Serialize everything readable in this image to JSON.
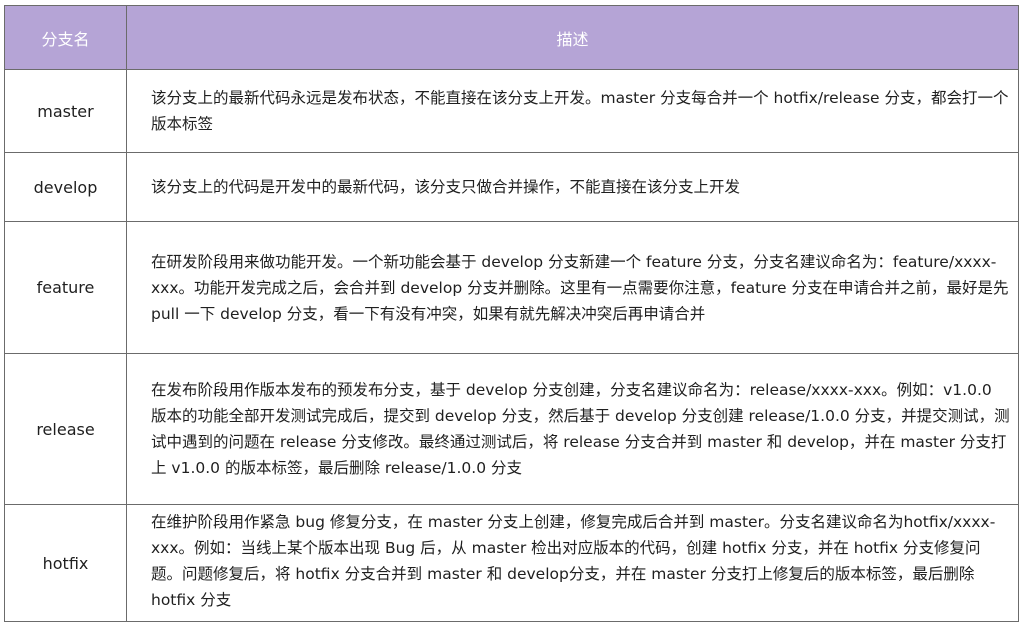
{
  "header": {
    "col_name": "分支名",
    "col_desc": "描述"
  },
  "rows": [
    {
      "name": "master",
      "desc": "该分支上的最新代码永远是发布状态，不能直接在该分支上开发。master 分支每合并一个 hotfix/release 分支，都会打一个版本标签"
    },
    {
      "name": "develop",
      "desc": "该分支上的代码是开发中的最新代码，该分支只做合并操作，不能直接在该分支上开发"
    },
    {
      "name": "feature",
      "desc": "在研发阶段用来做功能开发。一个新功能会基于 develop 分支新建一个 feature 分支，分支名建议命名为：feature/xxxx-xxx。功能开发完成之后，会合并到 develop 分支并删除。这里有一点需要你注意，feature 分支在申请合并之前，最好是先 pull 一下 develop 分支，看一下有没有冲突，如果有就先解决冲突后再申请合并"
    },
    {
      "name": "release",
      "desc": "在发布阶段用作版本发布的预发布分支，基于 develop 分支创建，分支名建议命名为：release/xxxx-xxx。例如：v1.0.0 版本的功能全部开发测试完成后，提交到 develop 分支，然后基于 develop 分支创建 release/1.0.0 分支，并提交测试，测试中遇到的问题在 release 分支修改。最终通过测试后，将 release 分支合并到 master 和 develop，并在 master 分支打上 v1.0.0 的版本标签，最后删除 release/1.0.0 分支"
    },
    {
      "name": "hotfix",
      "desc": "在维护阶段用作紧急 bug 修复分支，在 master 分支上创建，修复完成后合并到 master。分支名建议命名为hotfix/xxxx-xxx。例如：当线上某个版本出现 Bug 后，从 master 检出对应版本的代码，创建 hotfix 分支，并在 hotfix 分支修复问题。问题修复后，将 hotfix 分支合并到 master 和 develop分支，并在 master 分支打上修复后的版本标签，最后删除 hotfix 分支"
    }
  ],
  "colors": {
    "header_bg": "#b5a4d6",
    "header_text": "#ffffff",
    "border": "#6b6b6b"
  }
}
